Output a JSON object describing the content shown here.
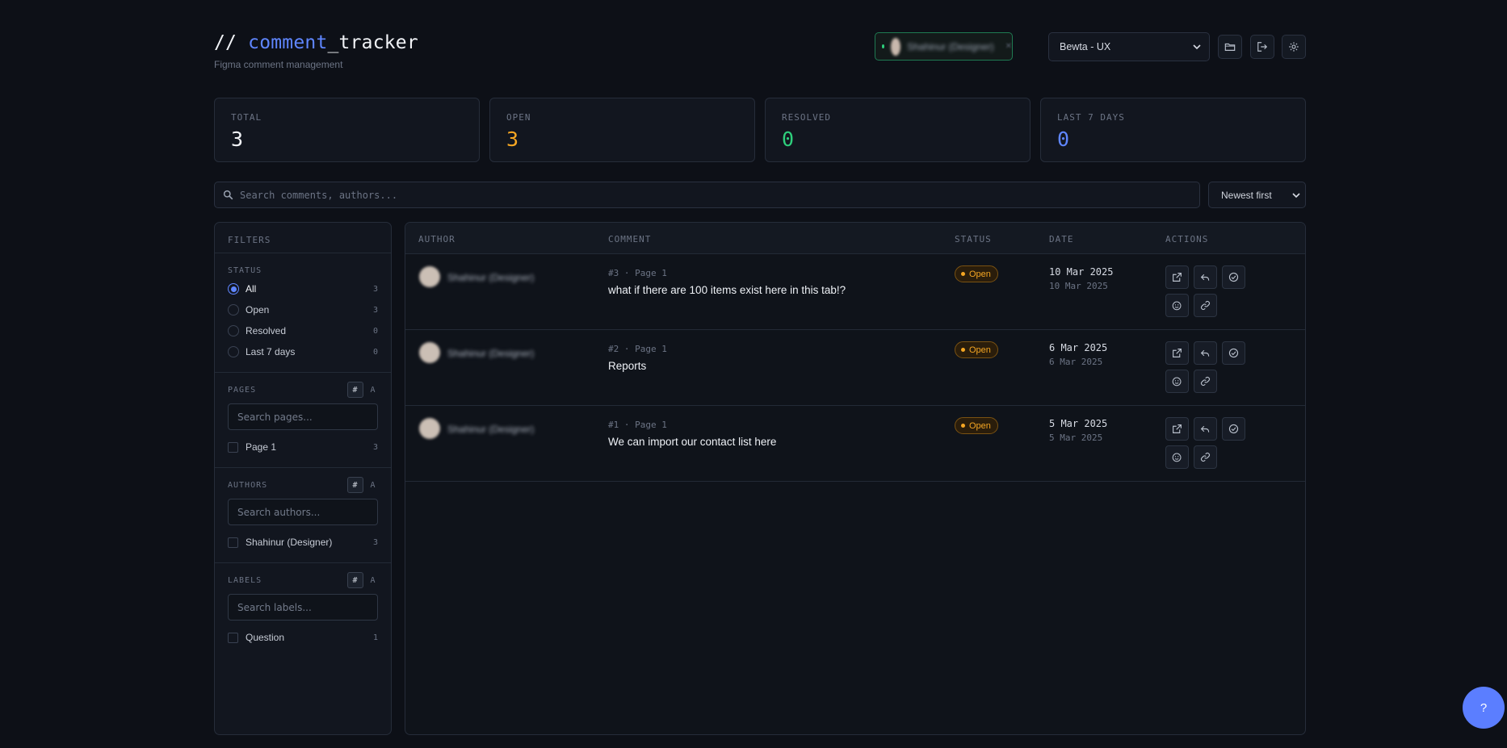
{
  "header": {
    "title_prefix": "// ",
    "title_accent": "comment",
    "title_suffix": "_tracker",
    "subtitle": "Figma comment management",
    "user_name": "Shahinur (Designer)",
    "project": "Bewta - UX"
  },
  "stats": [
    {
      "label": "TOTAL",
      "value": "3",
      "color": "#f1f3f7"
    },
    {
      "label": "OPEN",
      "value": "3",
      "color": "#f5a623"
    },
    {
      "label": "RESOLVED",
      "value": "0",
      "color": "#2ecf7c"
    },
    {
      "label": "LAST 7 DAYS",
      "value": "0",
      "color": "#5f86ff"
    }
  ],
  "search": {
    "placeholder": "Search comments, authors..."
  },
  "sort": {
    "selected": "Newest first"
  },
  "filters": {
    "title": "FILTERS",
    "status": {
      "title": "STATUS",
      "options": [
        {
          "label": "All",
          "count": "3"
        },
        {
          "label": "Open",
          "count": "3"
        },
        {
          "label": "Resolved",
          "count": "0"
        },
        {
          "label": "Last 7 days",
          "count": "0"
        }
      ]
    },
    "pages": {
      "title": "PAGES",
      "placeholder": "Search pages...",
      "items": [
        {
          "label": "Page 1",
          "count": "3"
        }
      ]
    },
    "authors": {
      "title": "AUTHORS",
      "placeholder": "Search authors...",
      "items": [
        {
          "label": "Shahinur (Designer)",
          "count": "3"
        }
      ]
    },
    "labels": {
      "title": "LABELS",
      "placeholder": "Search labels...",
      "items": [
        {
          "label": "Question",
          "count": "1"
        }
      ]
    },
    "toggle_hash": "#",
    "toggle_alpha": "A"
  },
  "table": {
    "columns": [
      "AUTHOR",
      "COMMENT",
      "STATUS",
      "DATE",
      "ACTIONS"
    ],
    "rows": [
      {
        "author": "Shahinur (Designer)",
        "meta": "#3 · Page 1",
        "text": "what if there are 100 items exist here in this tab!?",
        "status": "Open",
        "date": "10 Mar 2025",
        "date_sub": "10 Mar 2025"
      },
      {
        "author": "Shahinur (Designer)",
        "meta": "#2 · Page 1",
        "text": "Reports",
        "status": "Open",
        "date": "6 Mar 2025",
        "date_sub": "6 Mar 2025"
      },
      {
        "author": "Shahinur (Designer)",
        "meta": "#1 · Page 1",
        "text": "We can import our contact list here",
        "status": "Open",
        "date": "5 Mar 2025",
        "date_sub": "5 Mar 2025"
      }
    ]
  },
  "help": {
    "label": "?"
  }
}
